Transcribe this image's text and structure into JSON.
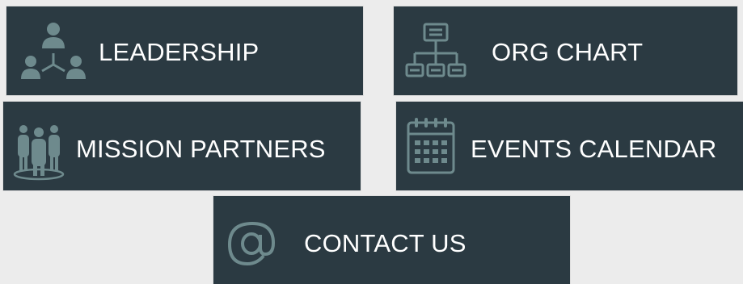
{
  "tiles": {
    "leadership": {
      "label": "LEADERSHIP",
      "icon": "leadership-people-icon"
    },
    "org_chart": {
      "label": "ORG CHART",
      "icon": "org-chart-icon"
    },
    "mission_partners": {
      "label": "MISSION PARTNERS",
      "icon": "group-people-icon"
    },
    "events_calendar": {
      "label": "EVENTS CALENDAR",
      "icon": "calendar-icon"
    },
    "contact_us": {
      "label": "CONTACT US",
      "icon": "at-sign-icon"
    }
  },
  "colors": {
    "page_background": "#ececec",
    "tile_background": "#2b3a42",
    "label_text": "#ffffff",
    "icon": "#6e8a8d"
  }
}
